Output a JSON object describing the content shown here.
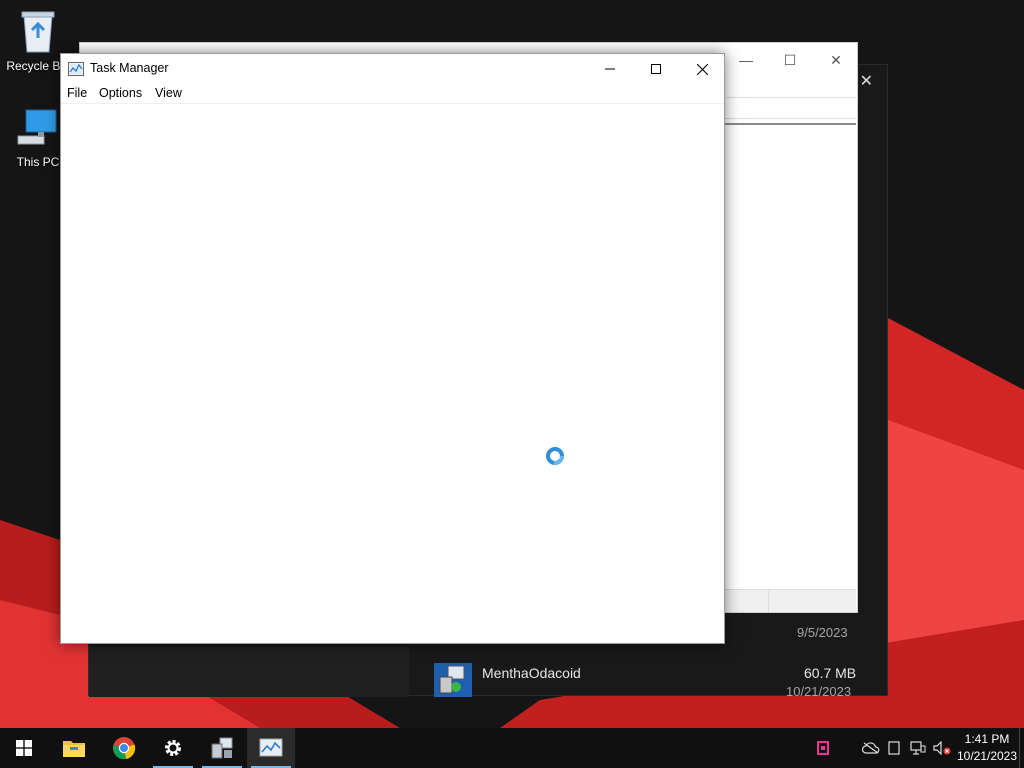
{
  "desktop": {
    "icons": [
      {
        "label": "Recycle Bin",
        "icon": "recycle-bin-icon"
      },
      {
        "label": "This PC",
        "icon": "computer-icon"
      }
    ]
  },
  "task_manager": {
    "title": "Task Manager",
    "menu": [
      "File",
      "Options",
      "View"
    ],
    "state": "loading"
  },
  "background_window": {
    "file_row_1": {
      "date": "9/5/2023"
    },
    "file_row_2": {
      "name": "MenthaOdacoid",
      "size": "60.7 MB",
      "date": "10/21/2023"
    }
  },
  "taskbar": {
    "pinned": [
      "start-icon",
      "file-explorer-icon",
      "chrome-icon",
      "settings-icon",
      "network-installer-icon",
      "task-manager-icon"
    ],
    "clock": {
      "time": "1:41 PM",
      "date": "10/21/2023"
    }
  },
  "colors": {
    "accent": "#76b9ed",
    "spinner": "#2f8fdc",
    "wallpaper_red": "#d42424"
  }
}
